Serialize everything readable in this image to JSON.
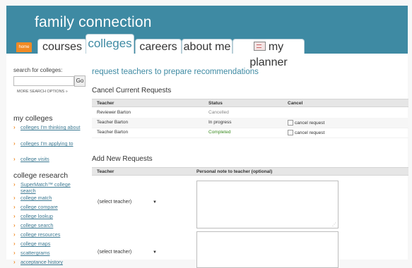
{
  "header": {
    "site_title": "family connection",
    "home_label": "home",
    "tabs": [
      {
        "label": "courses"
      },
      {
        "label": "colleges"
      },
      {
        "label": "careers"
      },
      {
        "label": "about me"
      },
      {
        "label": "my planner"
      }
    ]
  },
  "sidebar": {
    "search_label": "search for colleges:",
    "search_value": "",
    "go_label": "Go",
    "more_options": "MORE SEARCH OPTIONS »",
    "my_colleges_heading": "my colleges",
    "my_colleges_links": [
      "colleges I'm thinking about",
      "colleges I'm applying to",
      "college visits"
    ],
    "research_heading": "college research",
    "research_links": [
      "SuperMatch™ college search",
      "college match",
      "college compare",
      "college lookup",
      "college search",
      "college resources",
      "college maps",
      "scattergrams",
      "acceptance history"
    ]
  },
  "main": {
    "page_title": "request teachers to prepare recommendations",
    "cancel_section": {
      "title": "Cancel Current Requests",
      "columns": [
        "Teacher",
        "Status",
        "Cancel"
      ],
      "rows": [
        {
          "teacher": "Reviewer Barton",
          "status": "Cancelled",
          "cancel_label": ""
        },
        {
          "teacher": "Teacher Barton",
          "status": "In progress",
          "cancel_label": "cancel request"
        },
        {
          "teacher": "Teacher Barton",
          "status": "Completed",
          "cancel_label": "cancel request"
        }
      ]
    },
    "add_section": {
      "title": "Add New Requests",
      "columns": [
        "Teacher",
        "Personal note to teacher (optional)"
      ],
      "select_default": "(select teacher)"
    }
  },
  "colors": {
    "header_bg": "#3e8aa3",
    "accent_orange": "#f08a24",
    "link": "#3d7a93",
    "completed": "#3a8a1f"
  }
}
